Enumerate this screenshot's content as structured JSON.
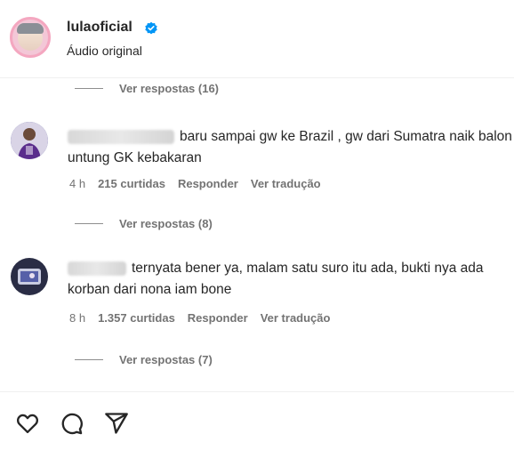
{
  "header": {
    "username": "lulaoficial",
    "subtitle": "Áudio original",
    "verified_color": "#0095f6"
  },
  "threads": [
    {
      "replies_label": "Ver respostas (16)"
    },
    {
      "comment": {
        "text": "baru sampai gw ke Brazil , gw dari Sumatra naik balon untung GK kebakaran",
        "time": "4 h",
        "likes": "215 curtidas",
        "reply": "Responder",
        "translate": "Ver tradução"
      },
      "replies_label": "Ver respostas (8)"
    },
    {
      "comment": {
        "text": "ternyata bener ya, malam satu suro itu ada, bukti nya ada korban dari nona iam bone",
        "time": "8 h",
        "likes": "1.357 curtidas",
        "reply": "Responder",
        "translate": "Ver tradução"
      },
      "replies_label": "Ver respostas (7)"
    }
  ],
  "actions": [
    "heart-icon",
    "comment-icon",
    "share-icon"
  ]
}
